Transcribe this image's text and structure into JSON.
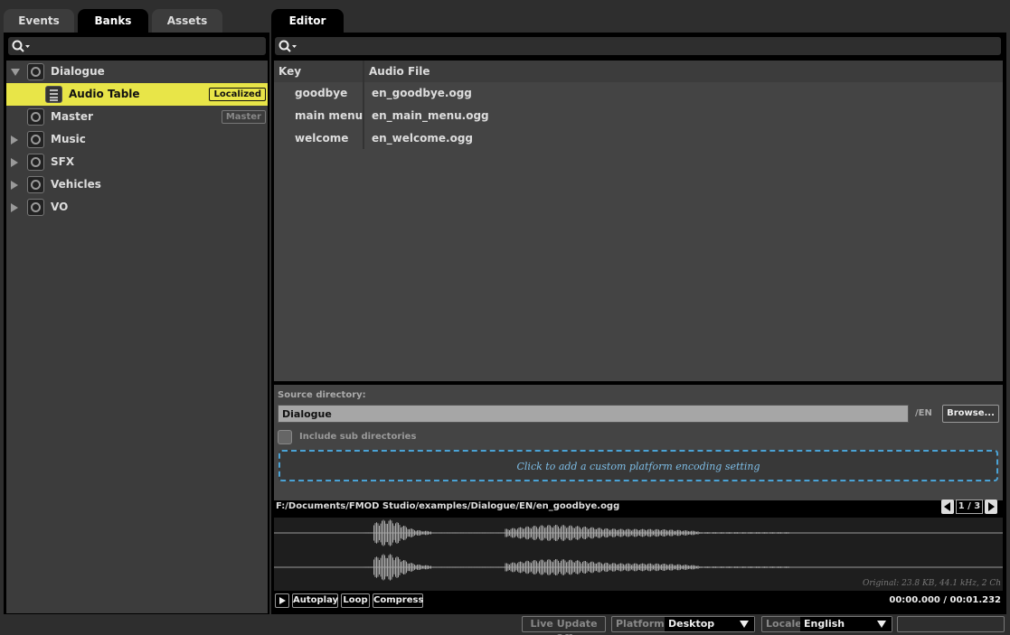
{
  "left_tabs": [
    "Events",
    "Banks",
    "Assets"
  ],
  "left_active_tab": "Banks",
  "tree": {
    "items": [
      {
        "label": "Dialogue",
        "expanded": true
      },
      {
        "label": "Audio Table",
        "badge": "Localized",
        "selected": true
      },
      {
        "label": "Master",
        "badge": "Master"
      },
      {
        "label": "Music"
      },
      {
        "label": "SFX"
      },
      {
        "label": "Vehicles"
      },
      {
        "label": "VO"
      }
    ]
  },
  "editor": {
    "tab": "Editor",
    "columns": {
      "key": "Key",
      "file": "Audio File"
    },
    "rows": [
      {
        "key": "goodbye",
        "file": "en_goodbye.ogg"
      },
      {
        "key": "main menu",
        "file": "en_main_menu.ogg"
      },
      {
        "key": "welcome",
        "file": "en_welcome.ogg"
      }
    ],
    "source_label": "Source directory:",
    "source_value": "Dialogue",
    "source_suffix": "/EN",
    "browse_label": "Browse...",
    "include_sub_label": "Include sub directories",
    "platform_hint": "Click to add a custom platform encoding setting",
    "file_path": "F:/Documents/FMOD Studio/examples/Dialogue/EN/en_goodbye.ogg",
    "pager": "1 / 3",
    "original_info": "Original: 23.8 KB, 44.1 kHz, 2 Ch",
    "play_icon": "play-icon",
    "autoplay_label": "Autoplay",
    "loop_label": "Loop",
    "compress_label": "Compress",
    "time": "00:00.000 / 00:01.232"
  },
  "status_bar": {
    "live_update": "Live Update Off",
    "platform_label": "Platform",
    "platform_value": "Desktop",
    "locale_label": "Locale",
    "locale_value": "English"
  },
  "colors": {
    "selection": "#e8e548",
    "accent": "#4aa3d6"
  }
}
